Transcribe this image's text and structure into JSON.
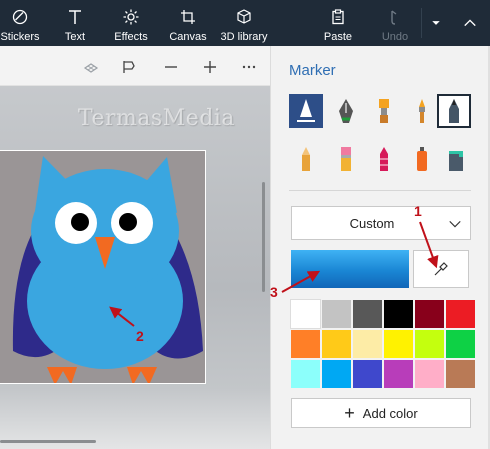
{
  "ribbon": {
    "items": [
      {
        "label": "Stickers",
        "icon": "stickers-icon"
      },
      {
        "label": "Text",
        "icon": "text-icon"
      },
      {
        "label": "Effects",
        "icon": "effects-icon"
      },
      {
        "label": "Canvas",
        "icon": "canvas-icon"
      },
      {
        "label": "3D library",
        "icon": "3d-library-icon"
      },
      {
        "label": "Paste",
        "icon": "paste-icon"
      },
      {
        "label": "Undo",
        "icon": "undo-icon",
        "disabled": true
      }
    ]
  },
  "canvas": {
    "watermark": "TermasMedia",
    "toolbar_icons": [
      "3d-view-icon",
      "flag-icon",
      "zoom-out-icon",
      "zoom-in-icon",
      "more-icon"
    ]
  },
  "panel": {
    "title": "Marker",
    "brushes_row1": [
      "marker-icon",
      "calligraphy-pen-icon",
      "oil-brush-icon",
      "watercolor-icon",
      "pixel-pen-icon"
    ],
    "brushes_row2": [
      "pencil-icon",
      "eraser-icon",
      "crayon-icon",
      "spray-can-icon",
      "fill-bucket-icon"
    ],
    "dropdown_value": "Custom",
    "selected_color": "#1a86d4",
    "swatches": [
      "#ffffff",
      "#c3c3c3",
      "#585858",
      "#000000",
      "#88001b",
      "#ec1c24",
      "#ff7f27",
      "#ffca18",
      "#fdeca6",
      "#fff200",
      "#c4ff0e",
      "#0ed145",
      "#8cfffb",
      "#00a8f3",
      "#3f48cc",
      "#b83dba",
      "#ffaec8",
      "#b97a56"
    ],
    "add_color_label": "Add color"
  },
  "annotations": {
    "marker1": "1",
    "marker2": "2",
    "marker3": "3"
  },
  "colors": {
    "ribbon_bg": "#1f2b38",
    "accent": "#2f6eb3",
    "annotation": "#c0111a",
    "owl_body": "#3aa6e0",
    "owl_wing": "#2e2a8a",
    "owl_beak": "#f26a21"
  }
}
